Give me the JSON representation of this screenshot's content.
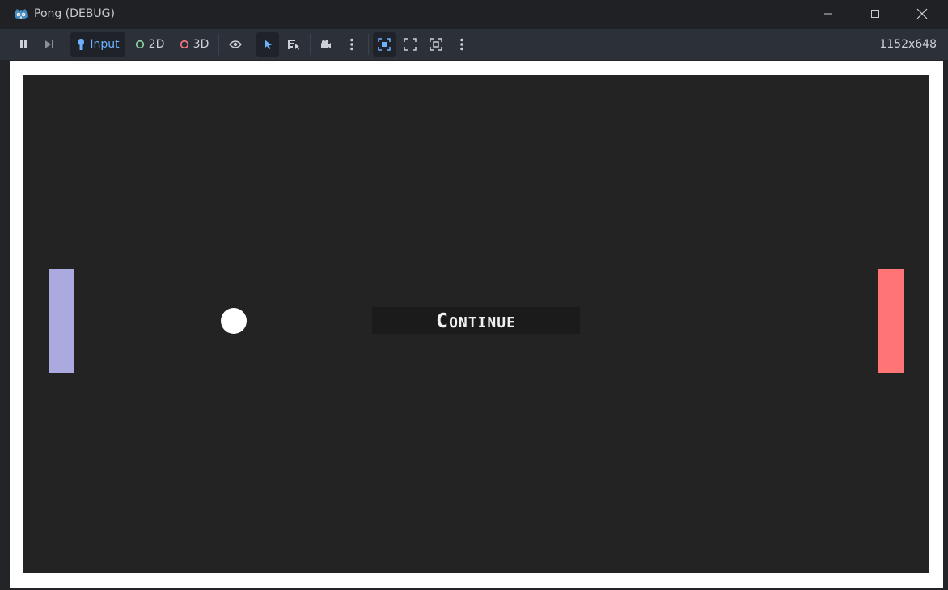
{
  "window": {
    "title": "Pong (DEBUG)",
    "icons": {
      "app": "godot-icon",
      "minimize": "minimize-icon",
      "maximize": "maximize-icon",
      "close": "close-icon"
    }
  },
  "toolbar": {
    "input_label": "Input",
    "label_2d": "2D",
    "label_3d": "3D",
    "resolution": "1152x648",
    "colors": {
      "accent": "#6cb2ff",
      "mode_2d": "#8ed9a6",
      "mode_3d": "#ff7a85"
    }
  },
  "game": {
    "continue_label": "Continue",
    "colors": {
      "background": "#232323",
      "left_paddle": "#aaaae0",
      "right_paddle": "#ff7575",
      "ball": "#ffffff"
    }
  }
}
